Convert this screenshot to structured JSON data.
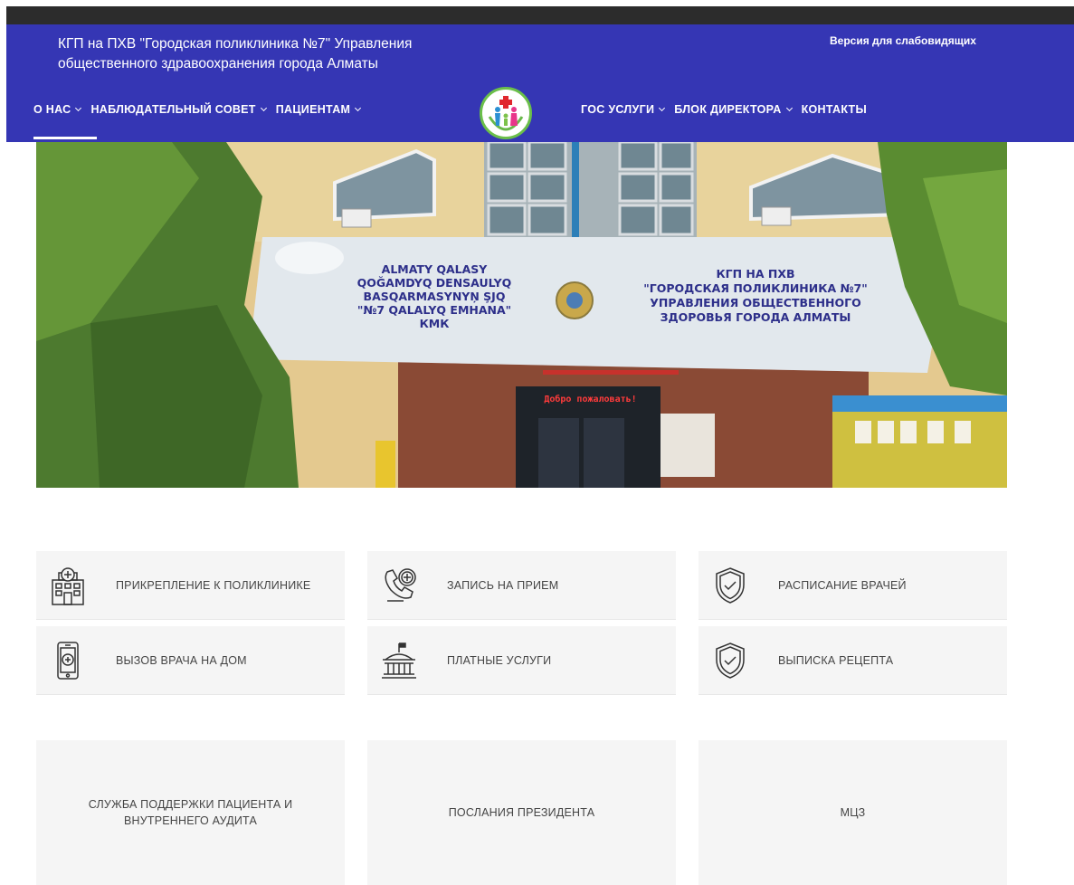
{
  "header": {
    "org_name": "КГП на ПХВ \"Городская поликлиника №7\" Управления общественного здравоохранения города Алматы",
    "accessibility_link": "Версия для слабовидящих",
    "bg_color": "#3536b4"
  },
  "nav": {
    "left": [
      {
        "label": "О НАС",
        "dropdown": true
      },
      {
        "label": "НАБЛЮДАТЕЛЬНЫЙ СОВЕТ",
        "dropdown": true
      },
      {
        "label": "ПАЦИЕНТАМ",
        "dropdown": true
      }
    ],
    "right": [
      {
        "label": "ГОС УСЛУГИ",
        "dropdown": true
      },
      {
        "label": "БЛОК ДИРЕКТОРА",
        "dropdown": true
      },
      {
        "label": "КОНТАКТЫ",
        "dropdown": false
      }
    ]
  },
  "hero": {
    "sign_left": [
      "ALMATY QALASY",
      "QOĞAMDYQ DENSAULYQ",
      "BASQARMASYNYŅ ŞJQ",
      "\"№7 QALALYQ EMHANA\" КМК"
    ],
    "sign_right": [
      "КГП НА ПХВ",
      "\"ГОРОДСКАЯ ПОЛИКЛИНИКА №7\"",
      "УПРАВЛЕНИЯ ОБЩЕСТВЕННОГО",
      "ЗДОРОВЬЯ ГОРОДА АЛМАТЫ"
    ],
    "led_text": "Добро пожаловать!"
  },
  "services": [
    {
      "label": "ПРИКРЕПЛЕНИЕ К ПОЛИКЛИНИКЕ",
      "icon": "hospital-icon"
    },
    {
      "label": "ЗАПИСЬ НА ПРИЕМ",
      "icon": "phone-plus-icon"
    },
    {
      "label": "РАСПИСАНИЕ ВРАЧЕЙ",
      "icon": "shield-check-icon"
    },
    {
      "label": "ВЫЗОВ ВРАЧА НА ДОМ",
      "icon": "mobile-plus-icon"
    },
    {
      "label": "ПЛАТНЫЕ УСЛУГИ",
      "icon": "building-columns-icon"
    },
    {
      "label": "ВЫПИСКА РЕЦЕПТА",
      "icon": "shield-check-icon"
    }
  ],
  "panels": [
    {
      "label": "СЛУЖБА ПОДДЕРЖКИ ПАЦИЕНТА И ВНУТРЕННЕГО АУДИТА"
    },
    {
      "label": "ПОСЛАНИЯ ПРЕЗИДЕНТА"
    },
    {
      "label": "МЦЗ"
    }
  ]
}
